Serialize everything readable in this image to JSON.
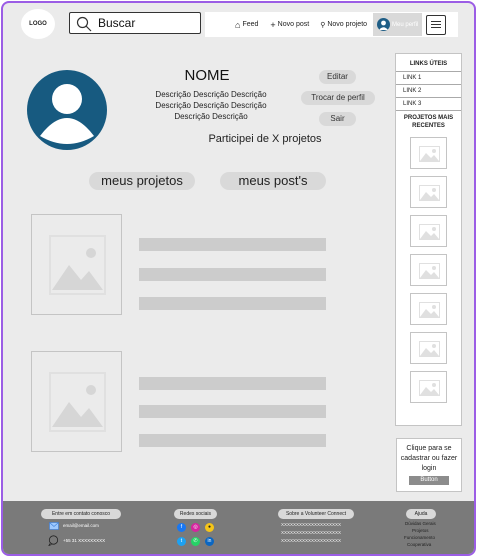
{
  "header": {
    "logo": "LOGO",
    "search_placeholder": "Buscar",
    "nav": [
      {
        "label": "Feed",
        "icon": "home-icon"
      },
      {
        "label": "Novo post",
        "icon": "plus-icon"
      },
      {
        "label": "Novo projeto",
        "icon": "search-icon"
      }
    ],
    "profile_label": "Meu perfil"
  },
  "profile": {
    "name": "NOME",
    "description": [
      "Descrição Descrição Descrição",
      "Descrição Descrição Descrição",
      "Descrição Descrição"
    ],
    "edit_label": "Editar",
    "switch_label": "Trocar de perfil",
    "logout_label": "Sair",
    "participation": "Participei de X projetos"
  },
  "tabs": [
    "meus projetos",
    "meus post's"
  ],
  "sidebar": {
    "title": "LINKS ÚTEIS",
    "links": [
      "LINK 1",
      "LINK 2",
      "LINK 3"
    ],
    "recent_title": "PROJETOS MAIS RECENTES"
  },
  "register": {
    "text": "Clique para se cadastrar ou fazer login",
    "button": "Button"
  },
  "footer": {
    "contact_title": "Entre em contato conosco",
    "email": "email@email.com",
    "phone": "+55 31 XXXXXXXXX",
    "social_title": "Redes sociais",
    "about_title": "Sobre a Volunteer Connect",
    "about_lines": [
      "XXXXXXXXXXXXXXXXXXXX",
      "XXXXXXXXXXXXXXXXXXXX",
      "XXXXXXXXXXXXXXXXXXXX"
    ],
    "help_title": "Ajuda",
    "help_items": [
      "Dúvidas Gerais",
      "Projetos",
      "Funcionamento",
      "Cooperativa"
    ]
  },
  "colors": {
    "accent": "#9b5de5",
    "avatar": "#175a80",
    "footer": "#7a7a7a"
  }
}
